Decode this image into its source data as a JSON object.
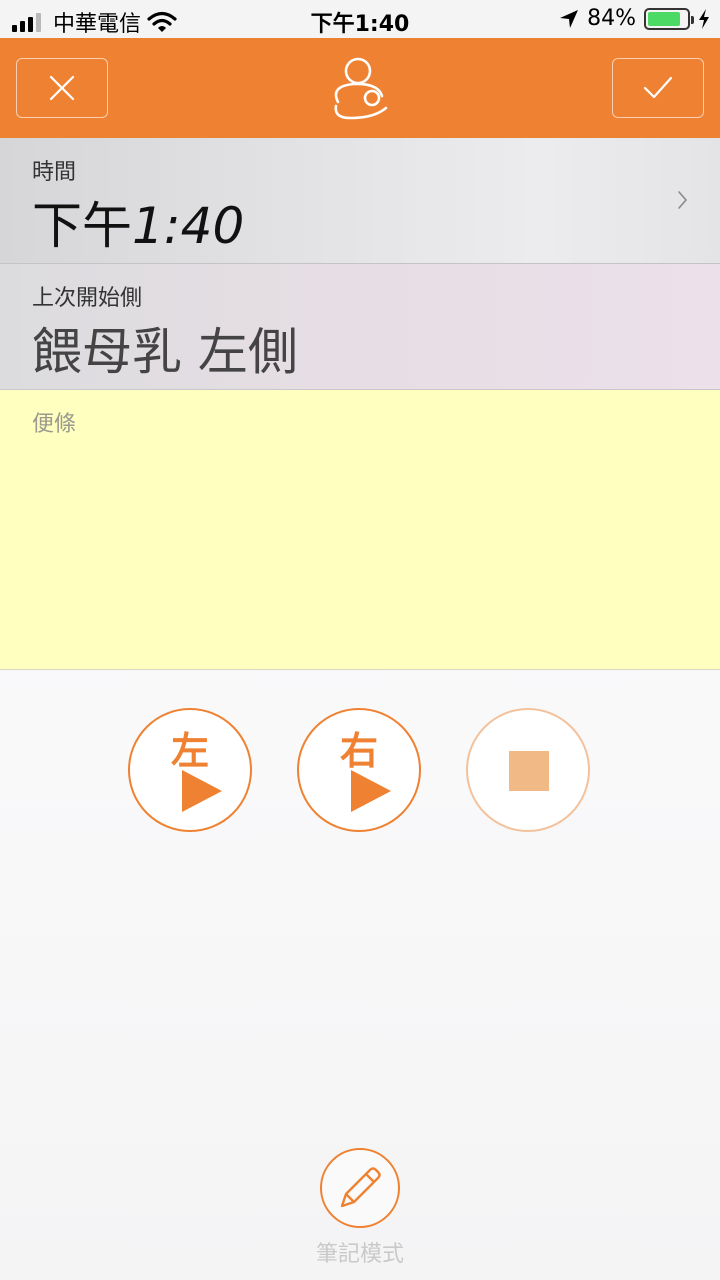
{
  "status_bar": {
    "carrier": "中華電信",
    "time": "下午1:40",
    "battery": "84%",
    "battery_level": 0.84,
    "icons": [
      "signal-icon",
      "wifi-icon",
      "location-icon",
      "battery-icon",
      "charging-icon"
    ]
  },
  "header": {
    "close_icon": "close-icon",
    "confirm_icon": "checkmark-icon",
    "logo_icon": "breastfeeding-icon"
  },
  "time_row": {
    "label": "時間",
    "value_prefix": "下午",
    "value_time": "1:40"
  },
  "last_side_row": {
    "label": "上次開始側",
    "value": "餵母乳 左側"
  },
  "notes": {
    "placeholder": "便條"
  },
  "controls": {
    "left_label": "左",
    "right_label": "右",
    "play_icon": "play-icon",
    "stop_icon": "stop-icon"
  },
  "note_mode": {
    "label": "筆記模式",
    "icon": "pencil-icon"
  },
  "colors": {
    "accent": "#ef8232",
    "notes_bg": "#ffffc0",
    "stop_fill": "#f1b985",
    "battery_green": "#4cd964"
  }
}
